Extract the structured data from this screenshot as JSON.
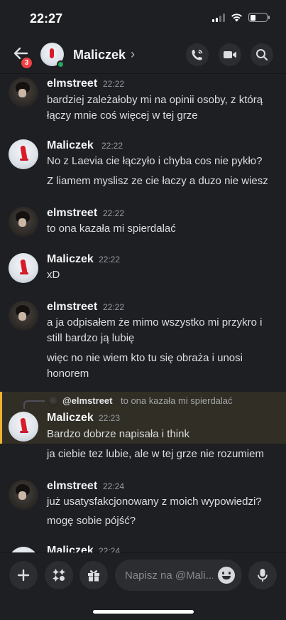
{
  "status_bar": {
    "time": "22:27"
  },
  "header": {
    "title": "Maliczek",
    "chevron": "›",
    "unread_badge": "3",
    "icons": [
      "back-arrow-icon",
      "call-icon",
      "video-icon",
      "search-icon"
    ]
  },
  "messages": [
    {
      "user": "elmstreet",
      "time": "22:22",
      "lines": [
        "bardziej zależałoby mi na opinii osoby, z którą",
        "łączy mnie coś więcej w tej grze"
      ]
    },
    {
      "user": "Maliczek",
      "time": "22:22",
      "lines": [
        "No z Laevia cie łączyło i chyba cos nie pykło?",
        "Z liamem myslisz ze cie łaczy a duzo nie wiesz"
      ]
    },
    {
      "user": "elmstreet",
      "time": "22:22",
      "lines": [
        "to ona kazała mi spierdalać"
      ]
    },
    {
      "user": "Maliczek",
      "time": "22:22",
      "lines": [
        "xD"
      ]
    },
    {
      "user": "elmstreet",
      "time": "22:22",
      "lines": [
        "a ja odpisałem że mimo wszystko mi przykro i",
        "still bardzo ją lubię",
        "więc no nie wiem kto tu się obraża i unosi",
        "honorem"
      ]
    },
    {
      "user": "Maliczek",
      "time": "22:23",
      "reply_to": {
        "user": "@elmstreet",
        "text": "to ona kazała mi spierdalać"
      },
      "lines": [
        "Bardzo dobrze napisała i think",
        "ja ciebie tez lubie, ale w tej grze nie rozumiem"
      ]
    },
    {
      "user": "elmstreet",
      "time": "22:24",
      "lines": [
        "już usatysfakcjonowany z moich wypowiedzi?",
        "mogę sobie pójść?"
      ]
    },
    {
      "user": "Maliczek",
      "time": "22:24",
      "lines": []
    }
  ],
  "composer": {
    "placeholder": "Napisz na @Mali...",
    "icons": [
      "plus-icon",
      "apps-icon",
      "gift-icon",
      "emoji-icon",
      "microphone-icon"
    ]
  },
  "colors": {
    "background": "#1e1f22",
    "online": "#23a55a",
    "badge": "#f23f43",
    "reply_highlight": "#f0b232"
  }
}
